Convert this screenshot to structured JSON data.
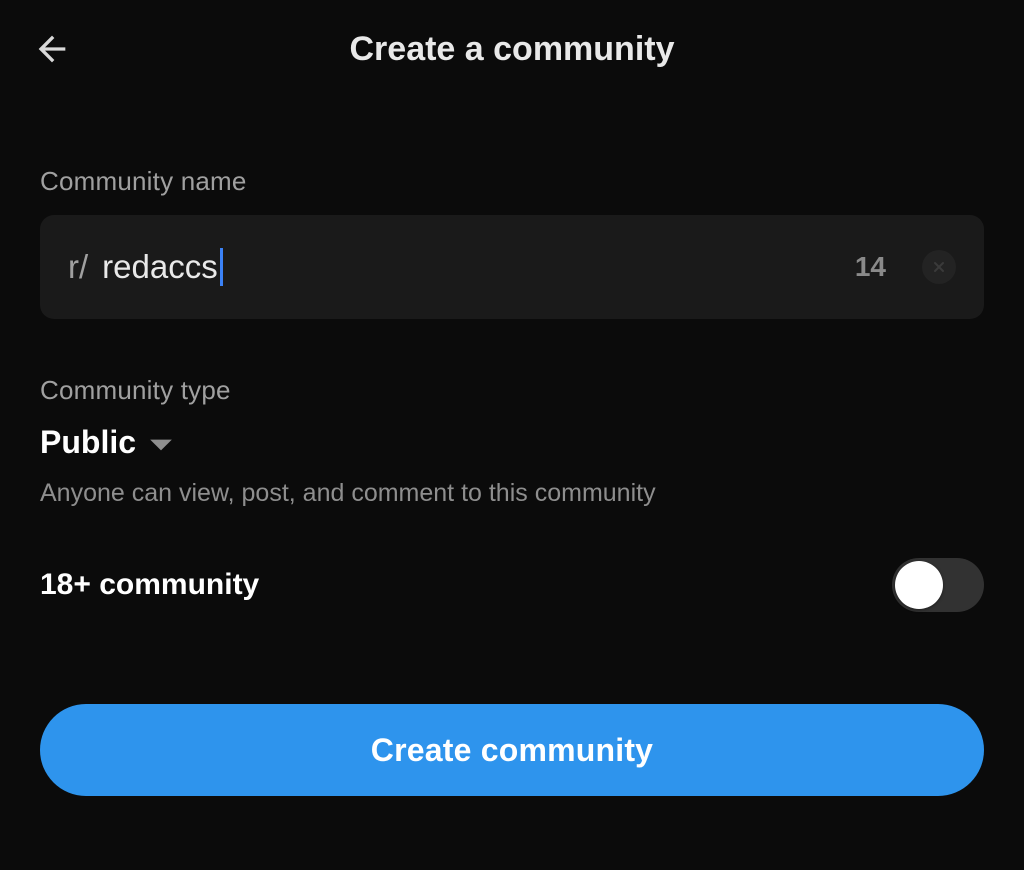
{
  "header": {
    "title": "Create a community"
  },
  "name": {
    "label": "Community name",
    "prefix": "r/",
    "value": "redaccs",
    "remaining": "14"
  },
  "type": {
    "label": "Community type",
    "value": "Public",
    "description": "Anyone can view, post, and comment to this community"
  },
  "adult": {
    "label": "18+ community",
    "enabled": false
  },
  "cta": {
    "label": "Create community"
  },
  "colors": {
    "accent": "#2e94ed"
  }
}
